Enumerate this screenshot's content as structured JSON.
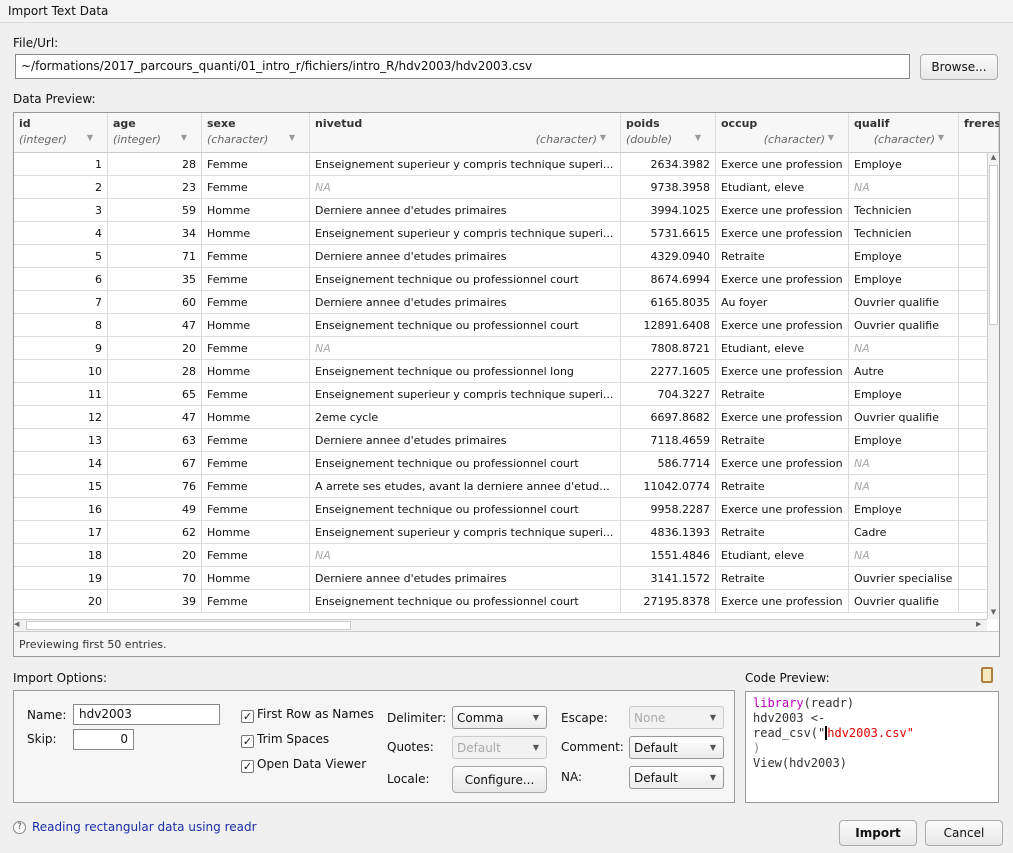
{
  "window": {
    "title": "Import Text Data"
  },
  "file": {
    "label": "File/Url:",
    "value": "~/formations/2017_parcours_quanti/01_intro_r/fichiers/intro_R/hdv2003/hdv2003.csv",
    "browse": "Browse..."
  },
  "preview": {
    "label": "Data Preview:",
    "footer": "Previewing first 50 entries.",
    "columns": [
      {
        "name": "id",
        "type": "(integer)"
      },
      {
        "name": "age",
        "type": "(integer)"
      },
      {
        "name": "sexe",
        "type": "(character)"
      },
      {
        "name": "nivetud",
        "type": "(character)"
      },
      {
        "name": "poids",
        "type": "(double)"
      },
      {
        "name": "occup",
        "type": "(character)"
      },
      {
        "name": "qualif",
        "type": "(character)"
      },
      {
        "name": "freres",
        "type": ""
      }
    ],
    "rows": [
      [
        "1",
        "28",
        "Femme",
        "Enseignement superieur y compris technique superi...",
        "2634.3982",
        "Exerce une profession",
        "Employe"
      ],
      [
        "2",
        "23",
        "Femme",
        "NA",
        "9738.3958",
        "Etudiant, eleve",
        "NA"
      ],
      [
        "3",
        "59",
        "Homme",
        "Derniere annee d'etudes primaires",
        "3994.1025",
        "Exerce une profession",
        "Technicien"
      ],
      [
        "4",
        "34",
        "Homme",
        "Enseignement superieur y compris technique superi...",
        "5731.6615",
        "Exerce une profession",
        "Technicien"
      ],
      [
        "5",
        "71",
        "Femme",
        "Derniere annee d'etudes primaires",
        "4329.0940",
        "Retraite",
        "Employe"
      ],
      [
        "6",
        "35",
        "Femme",
        "Enseignement technique ou professionnel court",
        "8674.6994",
        "Exerce une profession",
        "Employe"
      ],
      [
        "7",
        "60",
        "Femme",
        "Derniere annee d'etudes primaires",
        "6165.8035",
        "Au foyer",
        "Ouvrier qualifie"
      ],
      [
        "8",
        "47",
        "Homme",
        "Enseignement technique ou professionnel court",
        "12891.6408",
        "Exerce une profession",
        "Ouvrier qualifie"
      ],
      [
        "9",
        "20",
        "Femme",
        "NA",
        "7808.8721",
        "Etudiant, eleve",
        "NA"
      ],
      [
        "10",
        "28",
        "Homme",
        "Enseignement technique ou professionnel long",
        "2277.1605",
        "Exerce une profession",
        "Autre"
      ],
      [
        "11",
        "65",
        "Femme",
        "Enseignement superieur y compris technique superi...",
        "704.3227",
        "Retraite",
        "Employe"
      ],
      [
        "12",
        "47",
        "Homme",
        "2eme cycle",
        "6697.8682",
        "Exerce une profession",
        "Ouvrier qualifie"
      ],
      [
        "13",
        "63",
        "Femme",
        "Derniere annee d'etudes primaires",
        "7118.4659",
        "Retraite",
        "Employe"
      ],
      [
        "14",
        "67",
        "Femme",
        "Enseignement technique ou professionnel court",
        "586.7714",
        "Exerce une profession",
        "NA"
      ],
      [
        "15",
        "76",
        "Femme",
        "A arrete ses etudes, avant la derniere annee d'etud...",
        "11042.0774",
        "Retraite",
        "NA"
      ],
      [
        "16",
        "49",
        "Femme",
        "Enseignement technique ou professionnel court",
        "9958.2287",
        "Exerce une profession",
        "Employe"
      ],
      [
        "17",
        "62",
        "Homme",
        "Enseignement superieur y compris technique superi...",
        "4836.1393",
        "Retraite",
        "Cadre"
      ],
      [
        "18",
        "20",
        "Femme",
        "NA",
        "1551.4846",
        "Etudiant, eleve",
        "NA"
      ],
      [
        "19",
        "70",
        "Homme",
        "Derniere annee d'etudes primaires",
        "3141.1572",
        "Retraite",
        "Ouvrier specialise"
      ],
      [
        "20",
        "39",
        "Femme",
        "Enseignement technique ou professionnel court",
        "27195.8378",
        "Exerce une profession",
        "Ouvrier qualifie"
      ]
    ]
  },
  "options": {
    "label": "Import Options:",
    "name_label": "Name:",
    "name_value": "hdv2003",
    "skip_label": "Skip:",
    "skip_value": "0",
    "first_row": "First Row as Names",
    "trim": "Trim Spaces",
    "open_viewer": "Open Data Viewer",
    "first_row_checked": true,
    "trim_checked": true,
    "open_viewer_checked": true,
    "delimiter_label": "Delimiter:",
    "delimiter": "Comma",
    "quotes_label": "Quotes:",
    "quotes": "Default",
    "locale_label": "Locale:",
    "configure": "Configure...",
    "escape_label": "Escape:",
    "escape": "None",
    "comment_label": "Comment:",
    "comment": "Default",
    "na_label": "NA:",
    "na": "Default"
  },
  "code": {
    "label": "Code Preview:",
    "l1_fn": "library",
    "l1_rest": "(readr)",
    "l2a": "hdv2003 <- read_csv(\"",
    "l2b": "hdv2003.csv\"",
    "l3": ")",
    "l4": "View(hdv2003)"
  },
  "help": {
    "link": "Reading rectangular data using readr"
  },
  "actions": {
    "import": "Import",
    "cancel": "Cancel"
  },
  "colors": {
    "link": "#1a2ea8",
    "keyword": "#c000c0",
    "string": "#e00000"
  }
}
